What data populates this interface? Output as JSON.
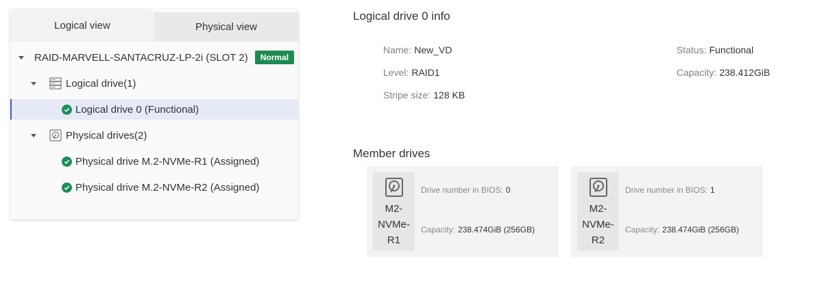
{
  "tabs": {
    "logical": "Logical view",
    "physical": "Physical view"
  },
  "tree": {
    "controller": {
      "label": "RAID-MARVELL-SANTACRUZ-LP-2i (SLOT 2)",
      "badge": "Normal"
    },
    "logical_group": {
      "label": "Logical drive(1)",
      "icon": "server-stack-icon"
    },
    "logical_items": [
      {
        "label": "Logical drive 0 (Functional)",
        "status": "ok"
      }
    ],
    "physical_group": {
      "label": "Physical drives(2)",
      "icon": "disk-icon"
    },
    "physical_items": [
      {
        "label": "Physical drive M.2-NVMe-R1 (Assigned)",
        "status": "ok"
      },
      {
        "label": "Physical drive M.2-NVMe-R2 (Assigned)",
        "status": "ok"
      }
    ]
  },
  "info": {
    "title": "Logical drive 0 info",
    "name": {
      "label": "Name:",
      "value": "New_VD"
    },
    "level": {
      "label": "Level:",
      "value": "RAID1"
    },
    "stripe": {
      "label": "Stripe size:",
      "value": "128 KB"
    },
    "status": {
      "label": "Status:",
      "value": "Functional"
    },
    "capacity": {
      "label": "Capacity:",
      "value": "238.412GiB"
    }
  },
  "members": {
    "title": "Member drives",
    "drives": [
      {
        "name": "M2-NVMe-R1",
        "bios_label": "Drive number in BIOS:",
        "bios_value": "0",
        "cap_label": "Capacity:",
        "cap_value": "238.474GiB (256GB)"
      },
      {
        "name": "M2-NVMe-R2",
        "bios_label": "Drive number in BIOS:",
        "bios_value": "1",
        "cap_label": "Capacity:",
        "cap_value": "238.474GiB (256GB)"
      }
    ]
  },
  "colors": {
    "ok": "#1e8e5a",
    "badge": "#1e8a52",
    "selected_bg": "#e6e9f6",
    "selected_border": "#4a5bb5"
  }
}
